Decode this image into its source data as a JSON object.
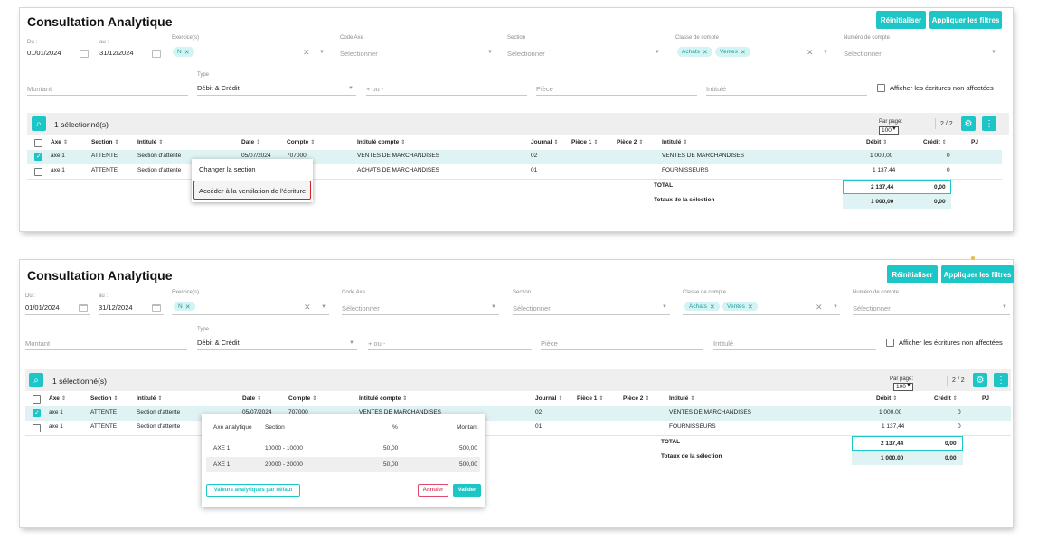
{
  "title": "Consultation Analytique",
  "buttons": {
    "reset": "Réinitialiser",
    "apply": "Appliquer les filtres"
  },
  "filters": {
    "du_label": "Du :",
    "du_value": "01/01/2024",
    "au_label": "au :",
    "au_value": "31/12/2024",
    "exercice_label": "Exercice(s)",
    "exercice_chip": "N",
    "code_axe_label": "Code Axe",
    "code_axe_placeholder": "Sélectionner",
    "section_label": "Section",
    "section_placeholder": "Sélectionner",
    "classe_label": "Classe de compte",
    "classe_chips": [
      "Achats",
      "Ventes"
    ],
    "numero_label": "Numéro de compte",
    "numero_placeholder": "Sélectionner",
    "montant_placeholder": "Montant",
    "type_label": "Type",
    "type_value": "Débit & Crédit",
    "plusmoins_placeholder": "+ ou -",
    "piece_placeholder": "Pièce",
    "intitule_placeholder": "Intitulé",
    "non_affectees_label": "Afficher les écritures non affectées"
  },
  "toolbar": {
    "selected_text": "1 sélectionné(s)",
    "per_page_label": "Par page:",
    "per_page_value": "100",
    "pager": "2 / 2"
  },
  "table": {
    "columns": [
      "Axe",
      "Section",
      "Intitulé",
      "Date",
      "Compte",
      "Intitulé compte",
      "Journal",
      "Pièce 1",
      "Pièce 2",
      "Intitulé",
      "Débit",
      "Crédit",
      "PJ"
    ],
    "rows": [
      {
        "axe": "axe 1",
        "section": "ATTENTE",
        "intitule": "Section d'attente",
        "date": "05/07/2024",
        "compte": "707000",
        "intitule_compte": "VENTES DE MARCHANDISES",
        "journal": "02",
        "intitule2": "VENTES DE MARCHANDISES",
        "debit": "1 000,00",
        "credit": "0",
        "selected": true
      },
      {
        "axe": "axe 1",
        "section": "ATTENTE",
        "intitule": "Section d'attente",
        "date": "",
        "compte": "",
        "intitule_compte": "ACHATS DE MARCHANDISES",
        "journal": "01",
        "intitule2": "FOURNISSEURS",
        "debit": "1 137,44",
        "credit": "0",
        "selected": false
      }
    ],
    "total_label": "TOTAL",
    "total_debit": "2 137,44",
    "total_credit": "0,00",
    "sel_label": "Totaux de la sélection",
    "sel_debit": "1 000,00",
    "sel_credit": "0,00"
  },
  "context_menu": {
    "item1": "Changer la section",
    "item2": "Accéder à la ventilation de l'écriture"
  },
  "popup": {
    "headers": [
      "Axe analytique",
      "Section",
      "%",
      "Montant"
    ],
    "rows": [
      {
        "axe": "AXE 1",
        "section": "10000 - 10000",
        "pct": "50,00",
        "montant": "500,00"
      },
      {
        "axe": "AXE 1",
        "section": "20000 - 20000",
        "pct": "50,00",
        "montant": "500,00"
      }
    ],
    "btn_default": "Valeurs analytiques par défaut",
    "btn_cancel": "Annuler",
    "btn_validate": "Valider"
  },
  "colors": {
    "accent": "#1dc6c6",
    "highlight_row": "#dff3f4",
    "context_border": "#d62020",
    "cancel": "#e04b6b"
  },
  "icons": [
    "calendar-icon",
    "search-icon",
    "gear-icon",
    "more-vert-icon",
    "close-icon",
    "chevron-down-icon",
    "sort-icon",
    "check-icon"
  ]
}
